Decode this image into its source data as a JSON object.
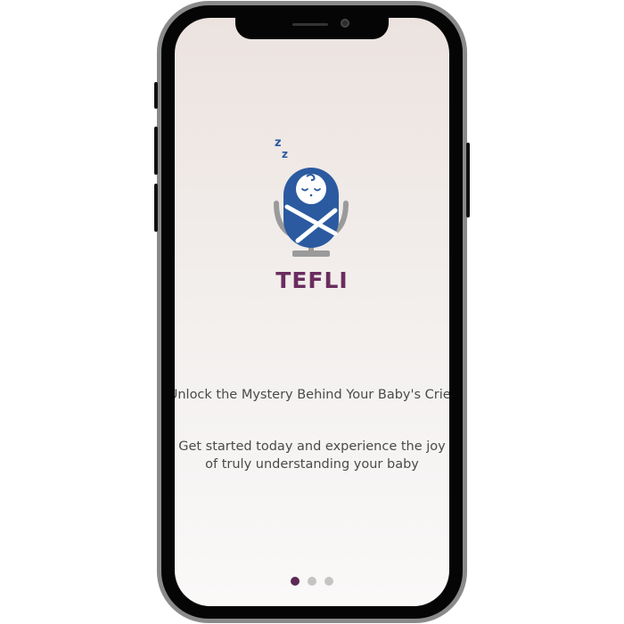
{
  "app": {
    "name": "TEFLI"
  },
  "onboarding": {
    "headline": "Unlock the Mystery Behind Your Baby's Cries",
    "subtext_line1": "Get started today and experience the joy",
    "subtext_line2": "of truly understanding your baby"
  },
  "pager": {
    "total": 3,
    "active_index": 0
  },
  "icons": {
    "logo": "sleeping-baby-microphone-logo"
  },
  "colors": {
    "brand": "#6a2d5e",
    "logo_blue": "#2b5aa0",
    "dot_active": "#5c2a55",
    "dot_inactive": "#c4c4c4"
  }
}
